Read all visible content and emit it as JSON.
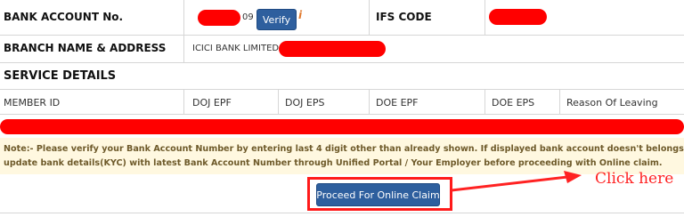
{
  "bank_row": {
    "label": "BANK ACCOUNT No.",
    "account_suffix": "09",
    "verify_label": "Verify",
    "info_glyph": "i",
    "ifs_label": "IFS CODE"
  },
  "branch_row": {
    "label": "BRANCH NAME & ADDRESS",
    "value_prefix": "ICICI BANK LIMITED,"
  },
  "service": {
    "title": "SERVICE DETAILS",
    "columns": [
      "MEMBER ID",
      "DOJ EPF",
      "DOJ EPS",
      "DOE EPF",
      "DOE EPS",
      "Reason Of Leaving"
    ]
  },
  "note": {
    "line1": "Note:- Please verify your Bank Account Number by entering last 4 digit other than already shown. If displayed bank account doesn't belongs to you or is cl",
    "line2": "update bank details(KYC) with latest Bank Account Number through Unified Portal / Your Employer before proceeding with Online claim."
  },
  "actions": {
    "proceed_label": "Proceed For Online Claim"
  },
  "annotation": {
    "hint": "Click here"
  },
  "colors": {
    "redaction": "#ff0000",
    "button": "#2e5f9e",
    "note_background": "#fff8e0",
    "annotation": "#ff2222"
  },
  "icons": [
    "info-icon",
    "arrow-icon"
  ]
}
